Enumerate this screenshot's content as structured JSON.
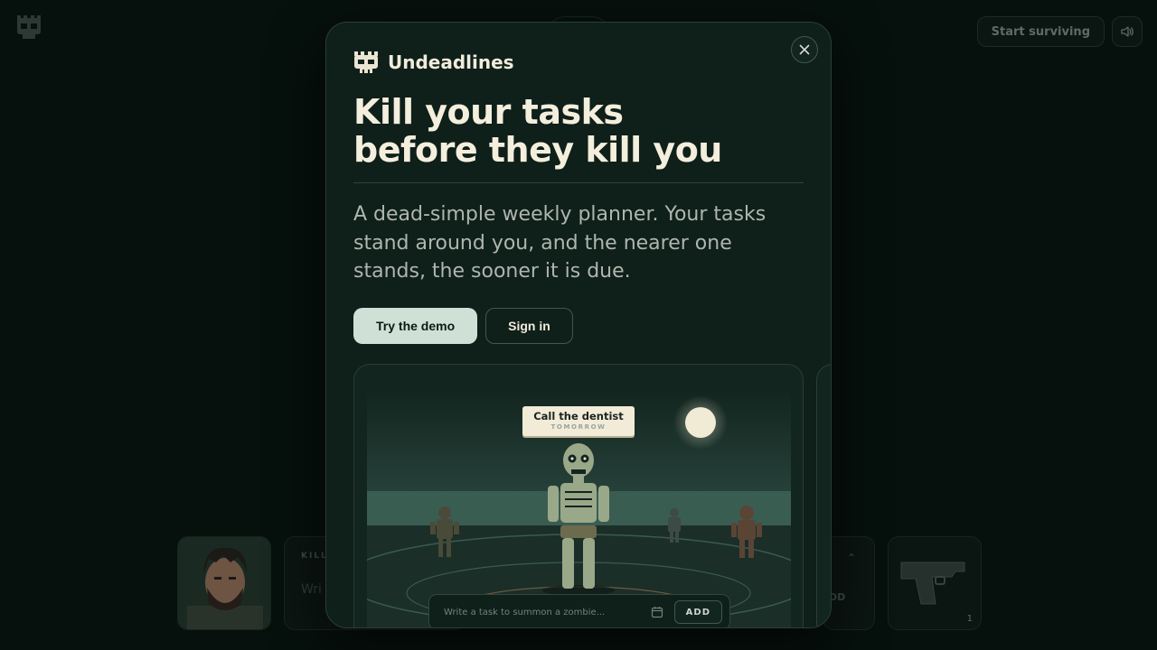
{
  "background": {
    "start_button": "Start surviving",
    "kill_label": "KILL",
    "kill_placeholder": "Wri",
    "add_label": "DD",
    "gun_count": "1"
  },
  "modal": {
    "brand_name": "Undeadlines",
    "headline_line1": "Kill your tasks",
    "headline_line2": "before they kill you",
    "tagline": "A dead-simple weekly planner. Your tasks stand around you, and the nearer one stands, the sooner it is due.",
    "try_demo_label": "Try the demo",
    "sign_in_label": "Sign in",
    "preview": {
      "task_title": "Call the dentist",
      "task_due": "TOMORROW",
      "composer_placeholder": "Write a task to summon a zombie...",
      "add_button": "ADD"
    }
  },
  "icons": {
    "brand": "skull-icon",
    "close": "close-icon",
    "sound": "speaker-icon",
    "calendar": "calendar-icon"
  },
  "colors": {
    "modal_bg": "#0f1f1a",
    "accent_button": "#cfe0d7",
    "headline": "#f4eedd",
    "moon": "#f1ead4"
  }
}
